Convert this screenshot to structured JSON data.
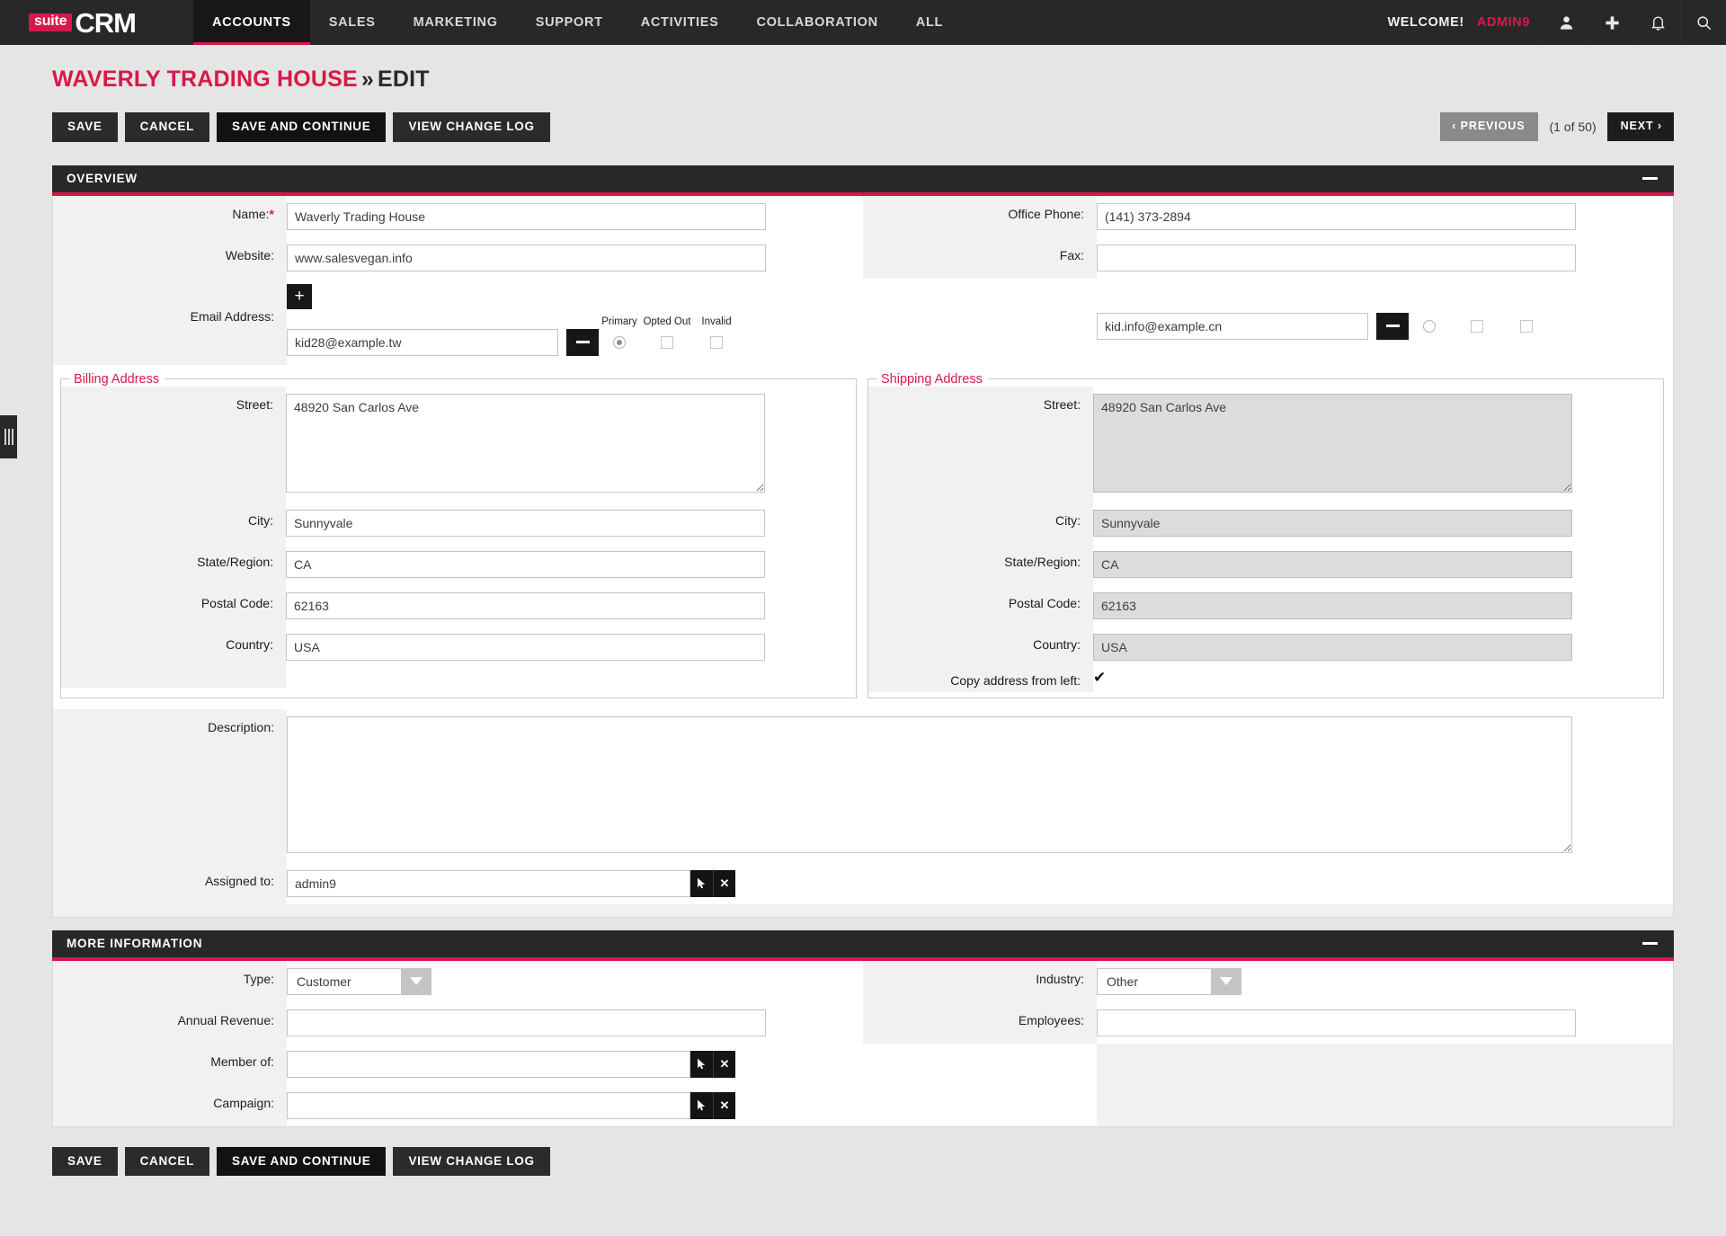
{
  "nav": {
    "brand": {
      "suite": "suite",
      "crm": "CRM"
    },
    "items": [
      {
        "label": "ACCOUNTS",
        "active": true
      },
      {
        "label": "SALES",
        "active": false
      },
      {
        "label": "MARKETING",
        "active": false
      },
      {
        "label": "SUPPORT",
        "active": false
      },
      {
        "label": "ACTIVITIES",
        "active": false
      },
      {
        "label": "COLLABORATION",
        "active": false
      },
      {
        "label": "ALL",
        "active": false
      }
    ],
    "welcome_label": "WELCOME!",
    "user": "ADMIN9",
    "icons": [
      "user-icon",
      "plus-icon",
      "bell-icon",
      "search-icon"
    ]
  },
  "header": {
    "record_name": "WAVERLY TRADING HOUSE",
    "separator": "»",
    "mode": "EDIT"
  },
  "toolbar": {
    "save": "SAVE",
    "cancel": "CANCEL",
    "save_continue": "SAVE AND CONTINUE",
    "view_change_log": "VIEW CHANGE LOG"
  },
  "pager": {
    "previous": "PREVIOUS",
    "count": "(1 of 50)",
    "next": "NEXT",
    "prev_chevron": "‹",
    "next_chevron": "›"
  },
  "panels": {
    "overview": {
      "title": "OVERVIEW",
      "labels": {
        "name": "Name:",
        "name_required": "*",
        "website": "Website:",
        "email": "Email Address:",
        "office_phone": "Office Phone:",
        "fax": "Fax:",
        "description": "Description:",
        "assigned_to": "Assigned to:"
      },
      "values": {
        "name": "Waverly Trading House",
        "website": "www.salesvegan.info",
        "office_phone": "(141) 373-2894",
        "fax": "",
        "description": "",
        "assigned_to": "admin9"
      },
      "email_headers": {
        "primary": "Primary",
        "opted_out": "Opted Out",
        "invalid": "Invalid"
      },
      "email_add_label": "+",
      "emails": [
        {
          "address": "kid28@example.tw",
          "primary": true,
          "opted_out": false,
          "invalid": false
        },
        {
          "address": "kid.info@example.cn",
          "primary": false,
          "opted_out": false,
          "invalid": false
        }
      ],
      "billing": {
        "legend": "Billing Address",
        "labels": {
          "street": "Street:",
          "city": "City:",
          "state": "State/Region:",
          "postal": "Postal Code:",
          "country": "Country:"
        },
        "values": {
          "street": "48920 San Carlos Ave",
          "city": "Sunnyvale",
          "state": "CA",
          "postal": "62163",
          "country": "USA"
        }
      },
      "shipping": {
        "legend": "Shipping Address",
        "labels": {
          "street": "Street:",
          "city": "City:",
          "state": "State/Region:",
          "postal": "Postal Code:",
          "country": "Country:",
          "copy": "Copy address from left:"
        },
        "values": {
          "street": "48920 San Carlos Ave",
          "city": "Sunnyvale",
          "state": "CA",
          "postal": "62163",
          "country": "USA"
        },
        "copy_checked": true,
        "copy_glyph": "✔",
        "disabled": true
      }
    },
    "more_information": {
      "title": "MORE INFORMATION",
      "labels": {
        "type": "Type:",
        "annual_revenue": "Annual Revenue:",
        "member_of": "Member of:",
        "campaign": "Campaign:",
        "industry": "Industry:",
        "employees": "Employees:"
      },
      "values": {
        "type": "Customer",
        "annual_revenue": "",
        "member_of": "",
        "campaign": "",
        "industry": "Other",
        "employees": ""
      }
    }
  },
  "colors": {
    "accent": "#d6194a",
    "nav_bg": "#282828",
    "page_bg": "#e5e5e5",
    "label_bg": "#f1f1f1",
    "disabled_field": "#dcdcdc"
  }
}
